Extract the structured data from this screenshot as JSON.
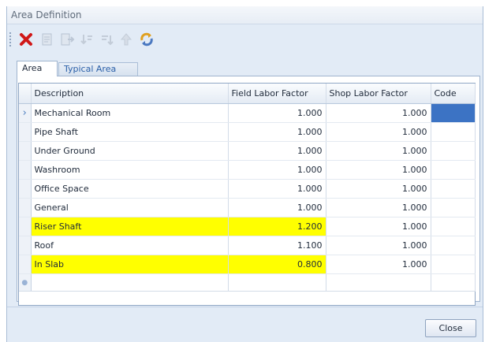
{
  "window": {
    "title": "Area Definition"
  },
  "toolbar": {
    "buttons": [
      {
        "icon": "delete-icon",
        "color": "#d01818"
      },
      {
        "icon": "edit-icon"
      },
      {
        "icon": "export-icon"
      },
      {
        "icon": "sort-icon"
      },
      {
        "icon": "sort-down-icon"
      },
      {
        "icon": "move-up-icon"
      },
      {
        "icon": "refresh-icon",
        "color": "#e0a020"
      }
    ]
  },
  "tabs": [
    {
      "label": "Area",
      "active": true
    },
    {
      "label": "Typical Area",
      "active": false
    }
  ],
  "grid": {
    "columns": [
      "Description",
      "Field Labor Factor",
      "Shop Labor Factor",
      "Code"
    ],
    "rows": [
      {
        "description": "Mechanical Room",
        "field": "1.000",
        "shop": "1.000",
        "code": "",
        "highlight": false,
        "current": true
      },
      {
        "description": "Pipe Shaft",
        "field": "1.000",
        "shop": "1.000",
        "code": "",
        "highlight": false
      },
      {
        "description": "Under Ground",
        "field": "1.000",
        "shop": "1.000",
        "code": "",
        "highlight": false
      },
      {
        "description": "Washroom",
        "field": "1.000",
        "shop": "1.000",
        "code": "",
        "highlight": false
      },
      {
        "description": "Office Space",
        "field": "1.000",
        "shop": "1.000",
        "code": "",
        "highlight": false
      },
      {
        "description": "General",
        "field": "1.000",
        "shop": "1.000",
        "code": "",
        "highlight": false
      },
      {
        "description": "Riser Shaft",
        "field": "1.200",
        "shop": "1.000",
        "code": "",
        "highlight": true
      },
      {
        "description": "Roof",
        "field": "1.100",
        "shop": "1.000",
        "code": "",
        "highlight": false
      },
      {
        "description": "In Slab",
        "field": "0.800",
        "shop": "1.000",
        "code": "",
        "highlight": true
      }
    ],
    "highlight_color": "#ffff00",
    "selection_color": "#3c73c4"
  },
  "footer": {
    "close_label": "Close"
  }
}
